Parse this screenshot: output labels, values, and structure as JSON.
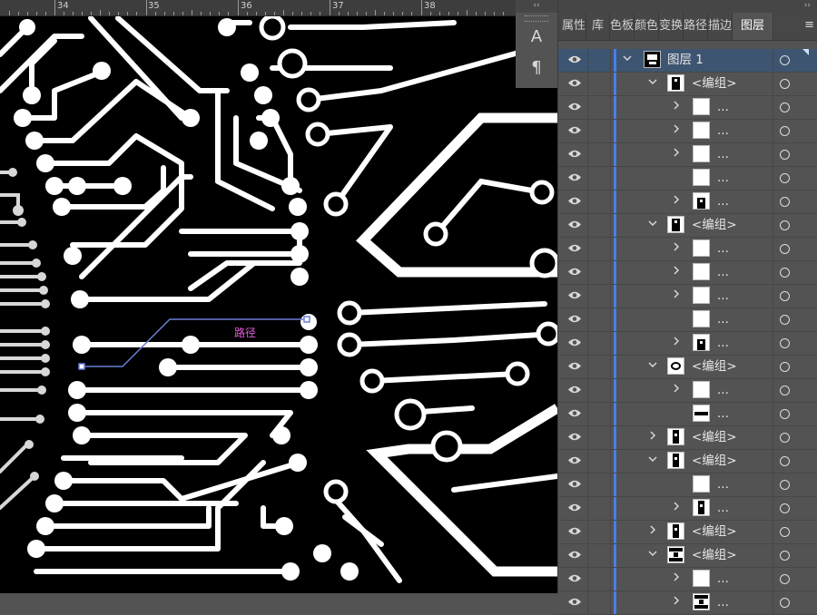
{
  "ruler": {
    "labels": [
      "34",
      "35",
      "36",
      "37",
      "38"
    ]
  },
  "canvas": {
    "path_label": "路径"
  },
  "toolstrip": {
    "collapse": "‹‹",
    "btn1": "A",
    "btn2": "¶"
  },
  "panel": {
    "collapse": "››",
    "tabs": [
      "属性",
      "库",
      "色板",
      "颜色",
      "变换",
      "路径查找器",
      "描边",
      "图层"
    ],
    "active_tab": "图层",
    "menu_icon": "≡",
    "layers": [
      {
        "name": "图层 1",
        "level": 0,
        "expand": "down",
        "thumb": "layer",
        "selected": true
      },
      {
        "name": "<编组>",
        "level": 1,
        "expand": "down",
        "thumb": "group"
      },
      {
        "name": "...",
        "level": 2,
        "expand": "right",
        "thumb": "blank"
      },
      {
        "name": "...",
        "level": 2,
        "expand": "right",
        "thumb": "blank"
      },
      {
        "name": "...",
        "level": 2,
        "expand": "right",
        "thumb": "blank"
      },
      {
        "name": "...",
        "level": 2,
        "expand": "none",
        "thumb": "blank"
      },
      {
        "name": "...",
        "level": 2,
        "expand": "right",
        "thumb": "tower"
      },
      {
        "name": "<编组>",
        "level": 1,
        "expand": "down",
        "thumb": "group"
      },
      {
        "name": "...",
        "level": 2,
        "expand": "right",
        "thumb": "blank"
      },
      {
        "name": "...",
        "level": 2,
        "expand": "right",
        "thumb": "blank"
      },
      {
        "name": "...",
        "level": 2,
        "expand": "right",
        "thumb": "blank"
      },
      {
        "name": "...",
        "level": 2,
        "expand": "none",
        "thumb": "blank"
      },
      {
        "name": "...",
        "level": 2,
        "expand": "right",
        "thumb": "tower"
      },
      {
        "name": "<编组>",
        "level": 1,
        "expand": "down",
        "thumb": "circle"
      },
      {
        "name": "...",
        "level": 2,
        "expand": "right",
        "thumb": "blank"
      },
      {
        "name": "...",
        "level": 2,
        "expand": "none",
        "thumb": "bar"
      },
      {
        "name": "<编组>",
        "level": 1,
        "expand": "right",
        "thumb": "vbar"
      },
      {
        "name": "<编组>",
        "level": 1,
        "expand": "down",
        "thumb": "vbar"
      },
      {
        "name": "...",
        "level": 2,
        "expand": "none",
        "thumb": "blank"
      },
      {
        "name": "...",
        "level": 2,
        "expand": "right",
        "thumb": "vbar"
      },
      {
        "name": "<编组>",
        "level": 1,
        "expand": "right",
        "thumb": "vbar"
      },
      {
        "name": "<编组>",
        "level": 1,
        "expand": "down",
        "thumb": "hbar"
      },
      {
        "name": "...",
        "level": 2,
        "expand": "right",
        "thumb": "blank"
      },
      {
        "name": "...",
        "level": 2,
        "expand": "right",
        "thumb": "hbar"
      }
    ]
  },
  "colors": {
    "layer_color": "#4a7de8",
    "selection_path": "#6a7fd8",
    "path_label": "#e05bd8"
  }
}
